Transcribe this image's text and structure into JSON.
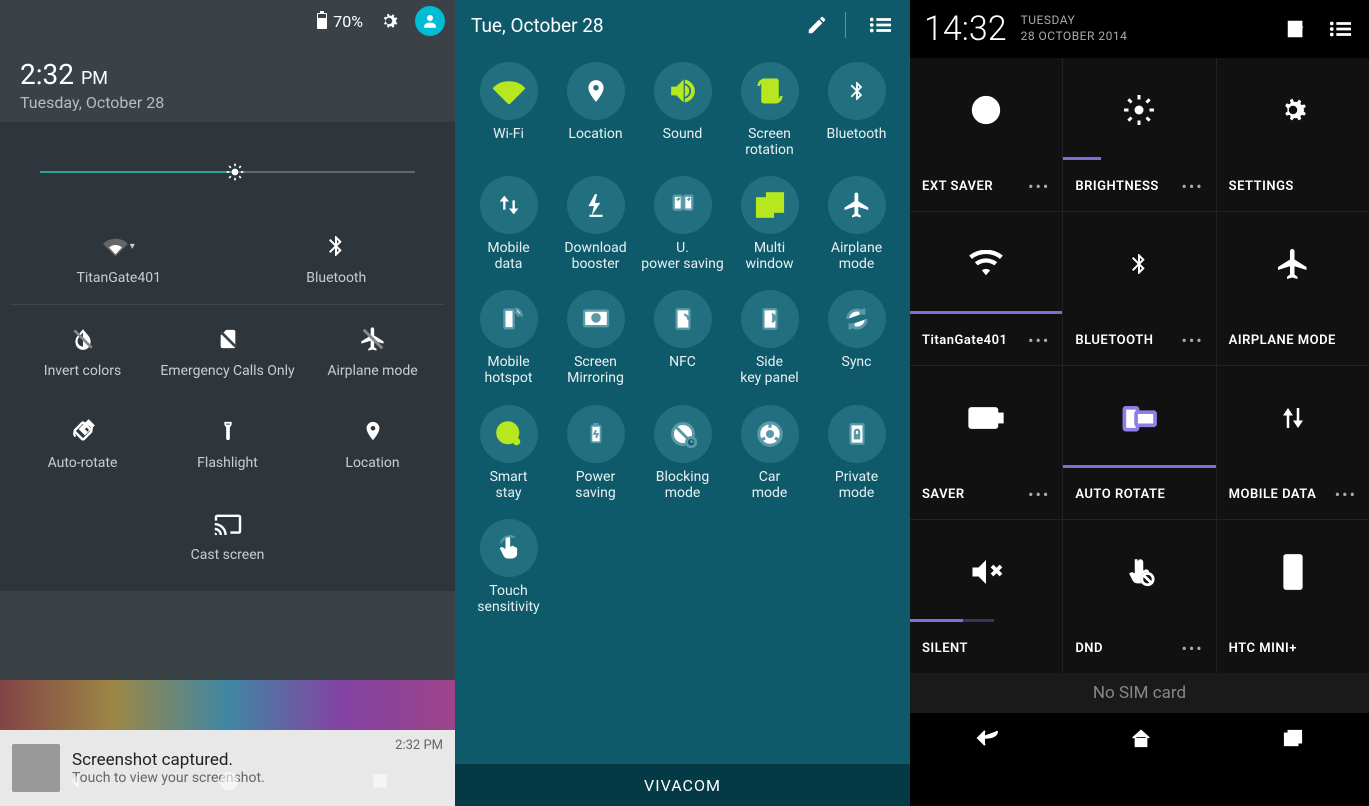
{
  "panel1": {
    "battery": "70%",
    "time": "2:32",
    "ampm": "PM",
    "date": "Tuesday, October 28",
    "brightness_pct": 52,
    "tiles_row1": [
      {
        "icon": "wifi",
        "label": "TitanGate401"
      },
      {
        "icon": "bluetooth",
        "label": "Bluetooth"
      }
    ],
    "tiles_row2": [
      {
        "icon": "invert",
        "label": "Invert colors"
      },
      {
        "icon": "sim",
        "label": "Emergency Calls Only"
      },
      {
        "icon": "airplane",
        "label": "Airplane mode"
      }
    ],
    "tiles_row3": [
      {
        "icon": "rotate",
        "label": "Auto-rotate"
      },
      {
        "icon": "flashlight",
        "label": "Flashlight"
      },
      {
        "icon": "location",
        "label": "Location"
      }
    ],
    "cast": "Cast screen",
    "notif": {
      "title": "Screenshot captured.",
      "sub": "Touch to view your screenshot.",
      "time": "2:32 PM"
    }
  },
  "panel2": {
    "date": "Tue, October 28",
    "carrier": "VIVACOM",
    "tiles": [
      {
        "icon": "wifi",
        "label": "Wi-Fi",
        "on": true
      },
      {
        "icon": "location",
        "label": "Location",
        "on": false
      },
      {
        "icon": "sound",
        "label": "Sound",
        "on": true
      },
      {
        "icon": "screenrot",
        "label": "Screen rotation",
        "on": true
      },
      {
        "icon": "bluetooth",
        "label": "Bluetooth",
        "on": false
      },
      {
        "icon": "mobiledata",
        "label": "Mobile data",
        "on": false
      },
      {
        "icon": "download",
        "label": "Download booster",
        "on": false
      },
      {
        "icon": "powersave",
        "label": "U. power saving",
        "on": false
      },
      {
        "icon": "multiwin",
        "label": "Multi window",
        "on": true
      },
      {
        "icon": "airplane",
        "label": "Airplane mode",
        "on": false
      },
      {
        "icon": "hotspot",
        "label": "Mobile hotspot",
        "on": false
      },
      {
        "icon": "mirror",
        "label": "Screen Mirroring",
        "on": false
      },
      {
        "icon": "nfc",
        "label": "NFC",
        "on": false
      },
      {
        "icon": "sidekey",
        "label": "Side key panel",
        "on": false
      },
      {
        "icon": "sync",
        "label": "Sync",
        "on": false
      },
      {
        "icon": "smartstay",
        "label": "Smart stay",
        "on": true
      },
      {
        "icon": "powersave2",
        "label": "Power saving",
        "on": false
      },
      {
        "icon": "blocking",
        "label": "Blocking mode",
        "on": false
      },
      {
        "icon": "car",
        "label": "Car mode",
        "on": false
      },
      {
        "icon": "private",
        "label": "Private mode",
        "on": false
      },
      {
        "icon": "touch",
        "label": "Touch sensitivity",
        "on": false
      }
    ]
  },
  "panel3": {
    "time": "14:32",
    "day": "TUESDAY",
    "date": "28 OCTOBER 2014",
    "sim": "No SIM card",
    "tiles": [
      {
        "icon": "leaf",
        "label": "EXT SAVER",
        "dots": true,
        "bar": [
          0,
          0,
          0
        ],
        "active": false
      },
      {
        "icon": "brightness",
        "label": "BRIGHTNESS",
        "dots": true,
        "bar": [
          25,
          0,
          0
        ],
        "active": false
      },
      {
        "icon": "gear",
        "label": "SETTINGS",
        "dots": false,
        "bar": [
          0,
          0,
          0
        ],
        "active": false
      },
      {
        "icon": "wifi",
        "label": "TitanGate401",
        "dots": true,
        "bar": [
          100,
          0,
          0
        ],
        "active": true
      },
      {
        "icon": "bluetooth",
        "label": "BLUETOOTH",
        "dots": true,
        "bar": [
          0,
          0,
          0
        ],
        "active": false
      },
      {
        "icon": "airplane",
        "label": "AIRPLANE MODE",
        "dots": false,
        "bar": [
          0,
          0,
          0
        ],
        "active": false
      },
      {
        "icon": "saver",
        "label": "SAVER",
        "dots": true,
        "bar": [
          0,
          0,
          0
        ],
        "active": false
      },
      {
        "icon": "autorotate",
        "label": "AUTO ROTATE",
        "dots": false,
        "bar": [
          100,
          0,
          0
        ],
        "active": true
      },
      {
        "icon": "mobiledata",
        "label": "MOBILE DATA",
        "dots": true,
        "bar": [
          0,
          0,
          0
        ],
        "active": false
      },
      {
        "icon": "silent",
        "label": "SILENT",
        "dots": false,
        "bar": [
          35,
          20,
          0
        ],
        "active": false
      },
      {
        "icon": "dnd",
        "label": "DND",
        "dots": true,
        "bar": [
          0,
          0,
          0
        ],
        "active": false
      },
      {
        "icon": "htcmini",
        "label": "HTC MINI+",
        "dots": false,
        "bar": [
          0,
          0,
          0
        ],
        "active": false
      }
    ]
  }
}
